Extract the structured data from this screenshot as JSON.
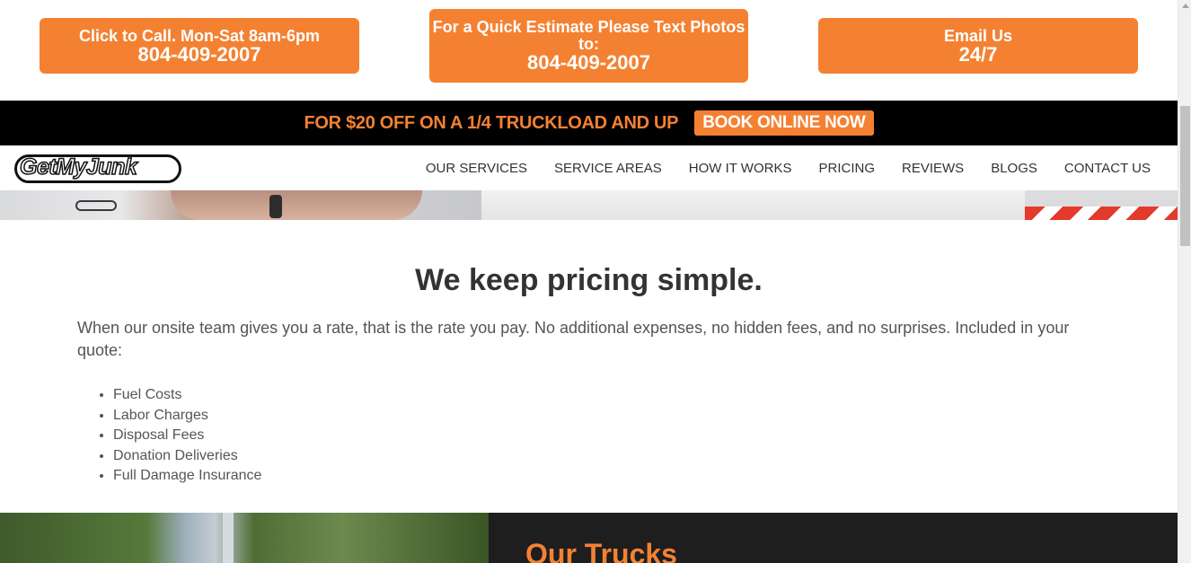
{
  "top_ctas": {
    "call": {
      "line1": "Click to Call. Mon-Sat 8am-6pm",
      "line2": "804-409-2007"
    },
    "text": {
      "line1": "For a Quick Estimate Please Text Photos to:",
      "line2": "804-409-2007"
    },
    "email": {
      "line1": "Email Us",
      "line2": "24/7"
    }
  },
  "promo": {
    "text": "FOR $20 OFF ON A 1/4 TRUCKLOAD AND UP",
    "button": "BOOK ONLINE NOW"
  },
  "logo": {
    "text": "GetMyJunk"
  },
  "nav": {
    "items": [
      "OUR SERVICES",
      "SERVICE AREAS",
      "HOW IT WORKS",
      "PRICING",
      "REVIEWS",
      "BLOGS",
      "CONTACT US"
    ]
  },
  "pricing": {
    "heading": "We keep pricing simple.",
    "body": "When our onsite team gives you a rate, that is the rate you pay. No additional expenses, no hidden fees, and no surprises. Included in your quote:",
    "list": [
      "Fuel Costs",
      "Labor Charges",
      "Disposal Fees",
      "Donation Deliveries",
      "Full Damage Insurance"
    ]
  },
  "trucks": {
    "heading": "Our Trucks"
  },
  "colors": {
    "accent": "#f48132",
    "promo_bg": "#000000",
    "trucks_bg": "#1e1e1e"
  }
}
